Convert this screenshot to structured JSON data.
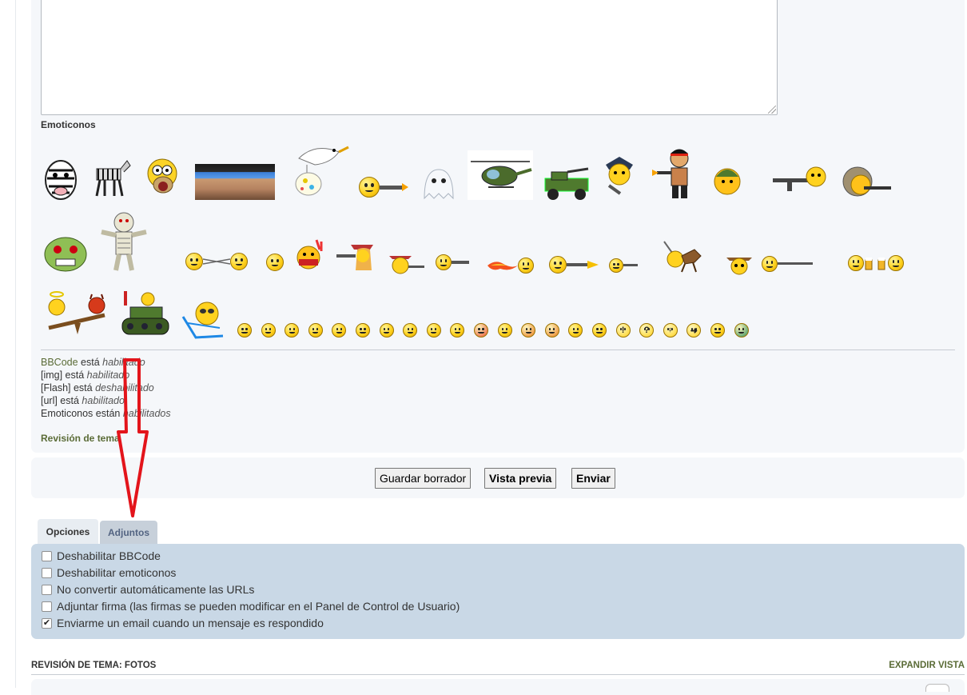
{
  "emoticons_title": "Emoticonos",
  "emoticons": {
    "row1": [
      "zebra",
      "zebra-walking",
      "homer",
      "cowboy-photo",
      "stork",
      "smiley-gun",
      "ghost",
      "helicopter",
      "jeep",
      "police",
      "rambo",
      "soldier",
      "machine-gun",
      "helmet-shooter"
    ],
    "row2": [
      "zombie",
      "mummy",
      "fencing",
      "boxer",
      "indian",
      "cowboy-girl",
      "cowboy-shooting",
      "sniper",
      "flamethrower",
      "shooter-fire",
      "shooter-small",
      "horse-rider",
      "cowboy-hat",
      "rifle-man",
      "beer-cheers"
    ],
    "row3": [
      "angel-devil-seesaw",
      "tank",
      "sunbather"
    ],
    "small": [
      "laugh",
      "smile",
      "sad",
      "surprised",
      "eek",
      "confused",
      "cool",
      "lol",
      "mad",
      "razz",
      "red-angry",
      "oops",
      "evil",
      "twisted",
      "rolleyes",
      "wink",
      "exclaim",
      "question",
      "idea",
      "arrow",
      "neutral",
      "mrgreen"
    ]
  },
  "status": {
    "bbcode_link": "BBCode",
    "bbcode_text": " está ",
    "bbcode_value": "habilitado",
    "img_text": "[img] está ",
    "img_value": "habilitado",
    "flash_text": "[Flash] está ",
    "flash_value": "deshabilitado",
    "url_text": "[url] está ",
    "url_value": "habilitado",
    "emo_text": "Emoticonos están ",
    "emo_value": "habilitados"
  },
  "review_link": "Revisión de tema",
  "buttons": {
    "save_draft": "Guardar borrador",
    "preview": "Vista previa",
    "submit": "Enviar"
  },
  "tabs": {
    "options": "Opciones",
    "attachments": "Adjuntos"
  },
  "options": [
    {
      "label": "Deshabilitar BBCode",
      "checked": false
    },
    {
      "label": "Deshabilitar emoticonos",
      "checked": false
    },
    {
      "label": "No convertir automáticamente las URLs",
      "checked": false
    },
    {
      "label": "Adjuntar firma (las firmas se pueden modificar en el Panel de Control de Usuario)",
      "checked": false
    },
    {
      "label": "Enviarme un email cuando un mensaje es respondido",
      "checked": true
    }
  ],
  "footer": {
    "title": "REVISIÓN DE TEMA: FOTOS",
    "expand": "EXPANDIR VISTA"
  },
  "colors": {
    "accent_link": "#5a6b36",
    "options_panel": "#c9d8e6",
    "arrow": "#e3141b"
  }
}
